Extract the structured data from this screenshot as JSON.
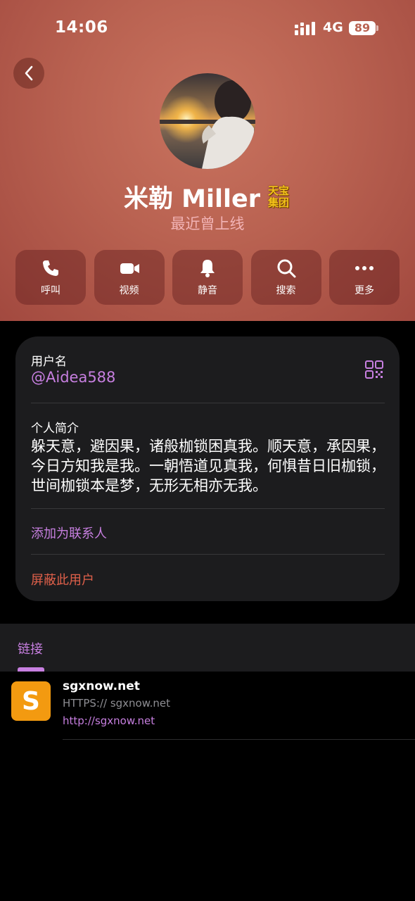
{
  "status_bar": {
    "time": "14:06",
    "network": "4G",
    "battery": "89"
  },
  "profile": {
    "name": "米勒 Miller",
    "badge_line1": "天宝",
    "badge_line2": "集团",
    "last_seen": "最近曾上线"
  },
  "actions": [
    {
      "label": "呼叫",
      "icon": "phone-icon"
    },
    {
      "label": "视频",
      "icon": "video-icon"
    },
    {
      "label": "静音",
      "icon": "bell-icon"
    },
    {
      "label": "搜索",
      "icon": "search-icon"
    },
    {
      "label": "更多",
      "icon": "more-icon"
    }
  ],
  "info": {
    "username_label": "用户名",
    "username": "@Aidea588",
    "bio_label": "个人简介",
    "bio": "躲天意，避因果，诸般枷锁困真我。顺天意，承因果，今日方知我是我。一朝悟道见真我，何惧昔日旧枷锁，世间枷锁本是梦，无形无相亦无我。",
    "add_contact": "添加为联系人",
    "block_user": "屏蔽此用户"
  },
  "links": {
    "tab_label": "链接",
    "items": [
      {
        "thumb_letter": "S",
        "title": "sgxnow.net",
        "description": "HTTPS:// sgxnow.net",
        "url": "http://sgxnow.net"
      }
    ]
  },
  "colors": {
    "accent": "#c77fe0",
    "danger": "#e0604a",
    "header": "#b96251"
  }
}
